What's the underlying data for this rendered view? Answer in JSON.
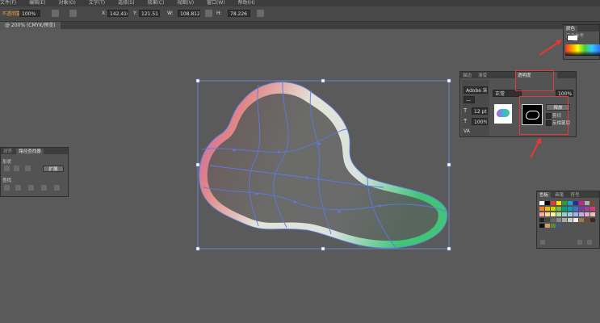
{
  "menubar": {
    "items": [
      "文件(F)",
      "编辑(E)",
      "对象(O)",
      "文字(T)",
      "选择(S)",
      "效果(C)",
      "视图(V)",
      "窗口(W)",
      "帮助(H)"
    ]
  },
  "control_bar": {
    "selection_label": "不透明蒙版",
    "opacity_value": "100%",
    "x_value": "142.416",
    "y_value": "121.51",
    "w_value": "108.812",
    "h_value": "78.226"
  },
  "document_tab": {
    "label": "@ 200% (CMYK/预览)"
  },
  "pathfinder_panel": {
    "tabs": [
      "对齐",
      "路径查找器"
    ],
    "shape_modes_label": "形状",
    "expand_label": "扩展",
    "pathfinders_label": "查找"
  },
  "transparency_panel": {
    "tabs": [
      "描边",
      "渐变",
      "透明度"
    ],
    "blend_mode": "正常",
    "opacity_value": "100%",
    "release_button": "释放",
    "clip_label": "剪切",
    "invert_label": "反相蒙版",
    "font_name": "Adobe 宋体",
    "font_size": "12 pt",
    "zoom": "100%"
  },
  "color_panel": {
    "tabs": [
      "颜色",
      "颜色参考"
    ]
  },
  "swatches_panel": {
    "tabs": [
      "色板",
      "画笔",
      "符号"
    ]
  },
  "colors": {
    "accent_red": "#e53935",
    "path_blue": "#5b7be0"
  }
}
